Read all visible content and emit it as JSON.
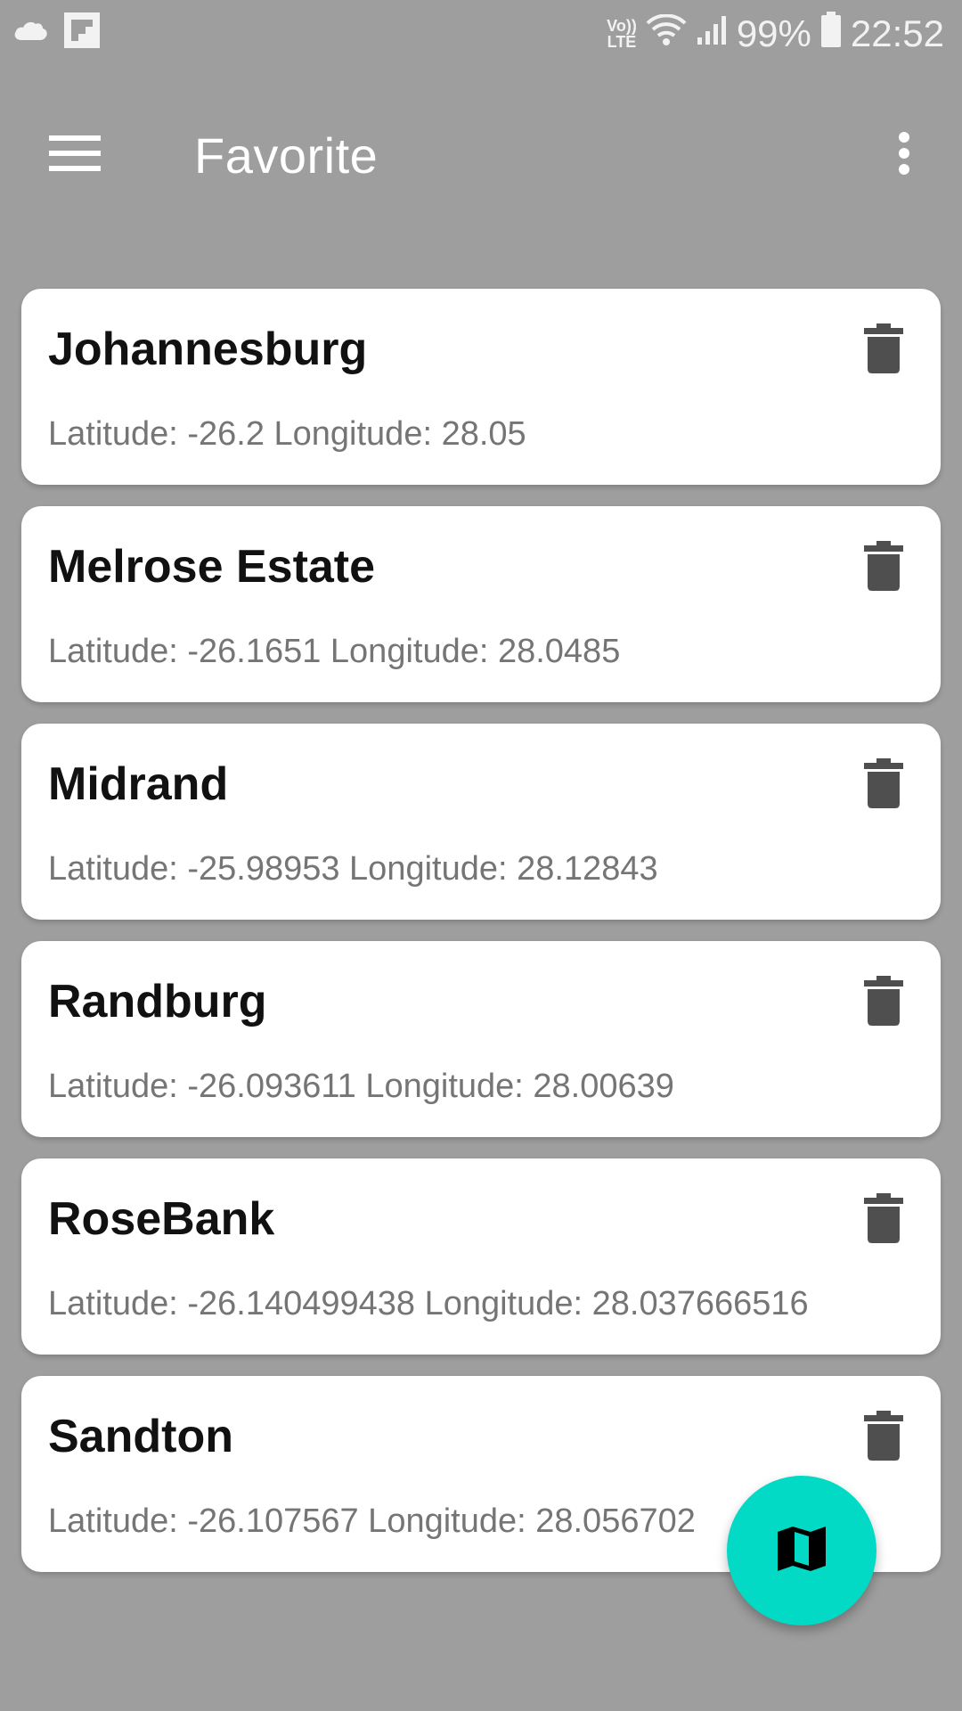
{
  "status_bar": {
    "volte_top": "Vo))",
    "volte_bottom": "LTE",
    "battery": "99%",
    "time": "22:52",
    "icons": [
      "cloud-icon",
      "flipboard-icon",
      "wifi-icon",
      "signal-icon",
      "battery-icon"
    ]
  },
  "toolbar": {
    "title": "Favorite",
    "menu_icon": "hamburger-menu-icon",
    "overflow_icon": "more-vertical-icon"
  },
  "favorites": [
    {
      "name": "Johannesburg",
      "coords": "Latitude: -26.2 Longitude: 28.05"
    },
    {
      "name": "Melrose Estate",
      "coords": "Latitude: -26.1651 Longitude: 28.0485"
    },
    {
      "name": "Midrand",
      "coords": "Latitude: -25.98953 Longitude: 28.12843"
    },
    {
      "name": "Randburg",
      "coords": "Latitude: -26.093611 Longitude: 28.00639"
    },
    {
      "name": "RoseBank",
      "coords": "Latitude: -26.140499438 Longitude: 28.037666516"
    },
    {
      "name": "Sandton",
      "coords": "Latitude: -26.107567 Longitude: 28.056702"
    }
  ],
  "fab": {
    "icon": "map-icon",
    "color": "#03dac5"
  },
  "colors": {
    "background": "#9e9e9e",
    "card": "#ffffff",
    "delete_icon": "#4f4f4f"
  }
}
